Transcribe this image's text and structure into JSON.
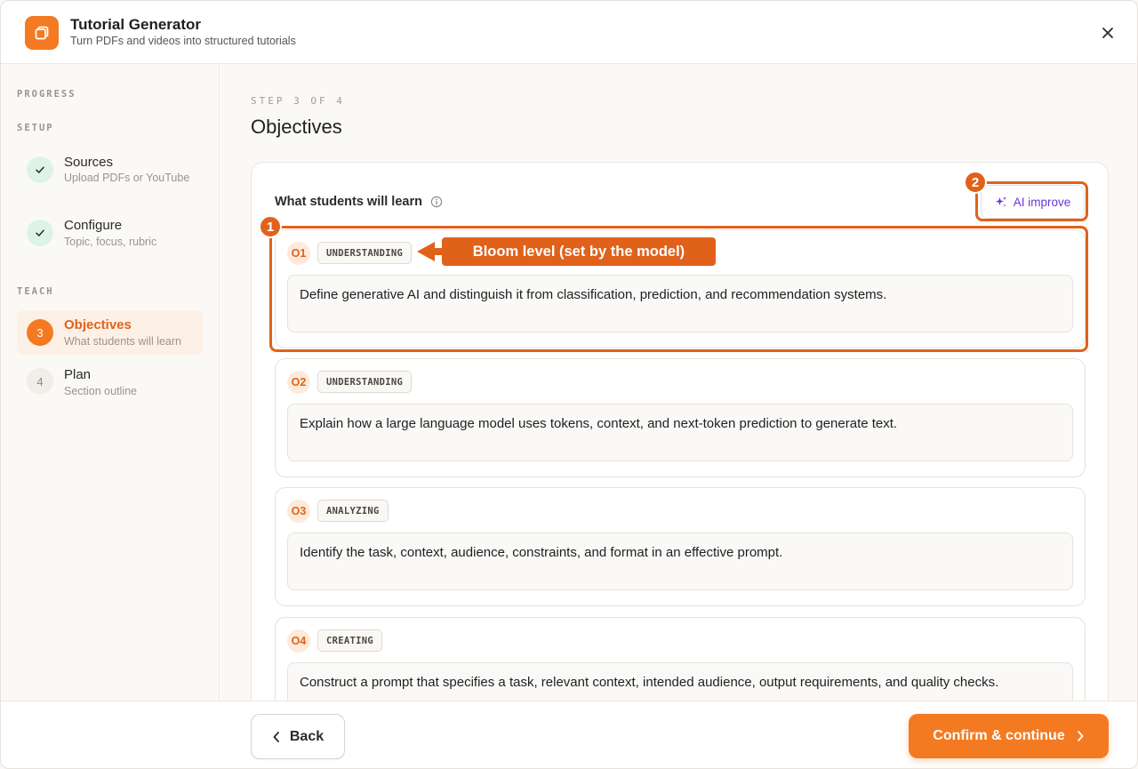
{
  "app": {
    "title": "Tutorial Generator",
    "subtitle": "Turn PDFs and videos into structured tutorials"
  },
  "sidebar": {
    "progress_heading": "PROGRESS",
    "setup_heading": "SETUP",
    "teach_heading": "TEACH",
    "steps": [
      {
        "num": "1",
        "title": "Sources",
        "sub": "Upload PDFs or YouTube",
        "state": "done"
      },
      {
        "num": "2",
        "title": "Configure",
        "sub": "Topic, focus, rubric",
        "state": "done"
      },
      {
        "num": "3",
        "title": "Objectives",
        "sub": "What students will learn",
        "state": "current"
      },
      {
        "num": "4",
        "title": "Plan",
        "sub": "Section outline",
        "state": "todo"
      }
    ]
  },
  "main": {
    "step_label": "STEP 3 OF 4",
    "page_title": "Objectives",
    "card_title": "What students will learn",
    "ai_improve_label": "AI improve",
    "objectives": [
      {
        "id": "O1",
        "bloom": "UNDERSTANDING",
        "text": "Define generative AI and distinguish it from classification, prediction, and recommendation systems."
      },
      {
        "id": "O2",
        "bloom": "UNDERSTANDING",
        "text": "Explain how a large language model uses tokens, context, and next-token prediction to generate text."
      },
      {
        "id": "O3",
        "bloom": "ANALYZING",
        "text": "Identify the task, context, audience, constraints, and format in an effective prompt."
      },
      {
        "id": "O4",
        "bloom": "CREATING",
        "text": "Construct a prompt that specifies a task, relevant context, intended audience, output requirements, and quality checks."
      }
    ]
  },
  "annotations": {
    "marker_1": "1",
    "marker_2": "2",
    "bloom_callout": "Bloom level (set by the model)"
  },
  "footer": {
    "back_label": "Back",
    "confirm_label": "Confirm & continue"
  },
  "colors": {
    "accent": "#f47a22",
    "accent_dark": "#e0621a",
    "ai_purple": "#6a35d8",
    "done_green": "#ddf3e6"
  }
}
